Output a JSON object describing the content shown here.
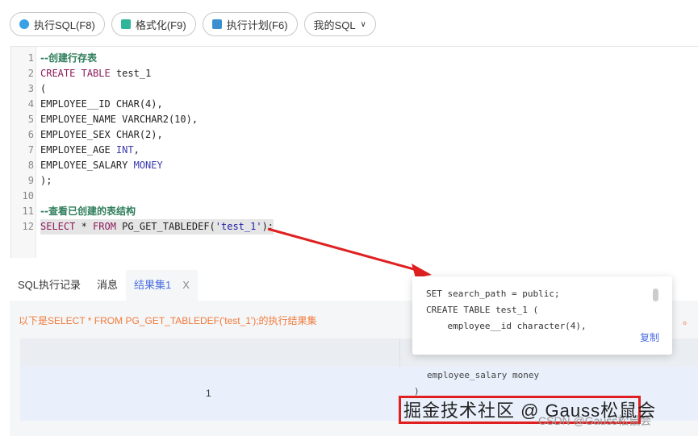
{
  "toolbar": {
    "run": "执行SQL(F8)",
    "format": "格式化(F9)",
    "plan": "执行计划(F6)",
    "mysql": "我的SQL"
  },
  "editor": {
    "lines": [
      {
        "n": "1",
        "text": "--创建行存表"
      },
      {
        "n": "2",
        "text": "CREATE TABLE test_1"
      },
      {
        "n": "3",
        "text": "("
      },
      {
        "n": "4",
        "text": "EMPLOYEE__ID CHAR(4),"
      },
      {
        "n": "5",
        "text": "EMPLOYEE_NAME VARCHAR2(10),"
      },
      {
        "n": "6",
        "text": "EMPLOYEE_SEX CHAR(2),"
      },
      {
        "n": "7",
        "text": "EMPLOYEE_AGE INT,"
      },
      {
        "n": "8",
        "text": "EMPLOYEE_SALARY MONEY"
      },
      {
        "n": "9",
        "text": ");"
      },
      {
        "n": "10",
        "text": ""
      },
      {
        "n": "11",
        "text": "--查看已创建的表结构"
      },
      {
        "n": "12",
        "text": "SELECT * FROM PG_GET_TABLEDEF('test_1');"
      }
    ]
  },
  "tabs": {
    "history": "SQL执行记录",
    "messages": "消息",
    "result": "结果集1",
    "close": "X"
  },
  "result": {
    "message": "以下是SELECT * FROM PG_GET_TABLEDEF('test_1');的执行结果集",
    "row_index": "1",
    "cell_line1": "employee_salary money",
    "cell_line2": ")",
    "trailing": "。"
  },
  "popup": {
    "line1": "SET search_path = public;",
    "line2": "CREATE TABLE test_1 (",
    "line3": "    employee__id character(4),",
    "copy": "复制"
  },
  "watermark": {
    "main": "掘金技术社区 @ Gauss松鼠会",
    "sub": "CSDN @Gauss松鼠会"
  }
}
